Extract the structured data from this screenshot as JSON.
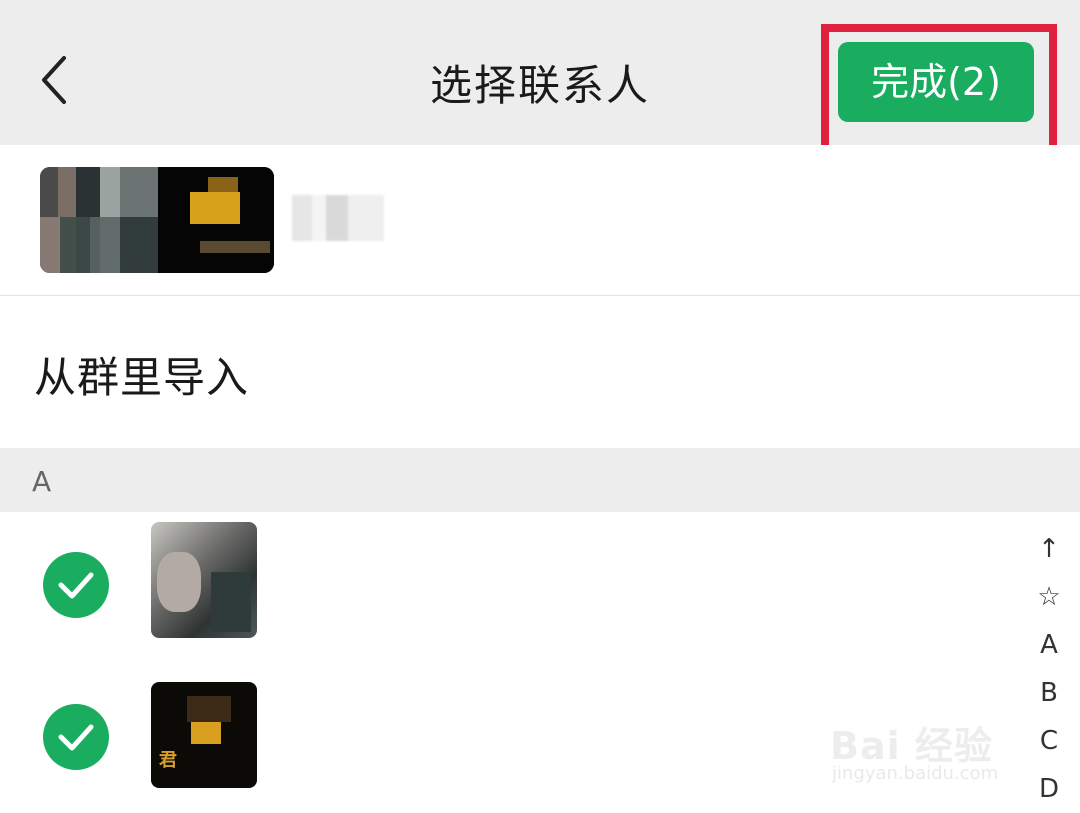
{
  "header": {
    "title": "选择联系人",
    "done_label": "完成(2)",
    "back_icon": "chevron-left-icon"
  },
  "group_row": {
    "name_blurred": true
  },
  "import_row": {
    "label": "从群里导入"
  },
  "section": {
    "letter": "A"
  },
  "contacts": [
    {
      "checked": true,
      "name_blurred": true
    },
    {
      "checked": true,
      "name_blurred": true,
      "avatar_text": "君"
    }
  ],
  "index_bar": [
    "↑",
    "☆",
    "A",
    "B",
    "C",
    "D"
  ],
  "watermark": {
    "main": "Bai 经验",
    "sub": "jingyan.baidu.com"
  },
  "colors": {
    "accent_green": "#1aad5f",
    "highlight_red": "#e0203f",
    "header_bg": "#ededed"
  }
}
